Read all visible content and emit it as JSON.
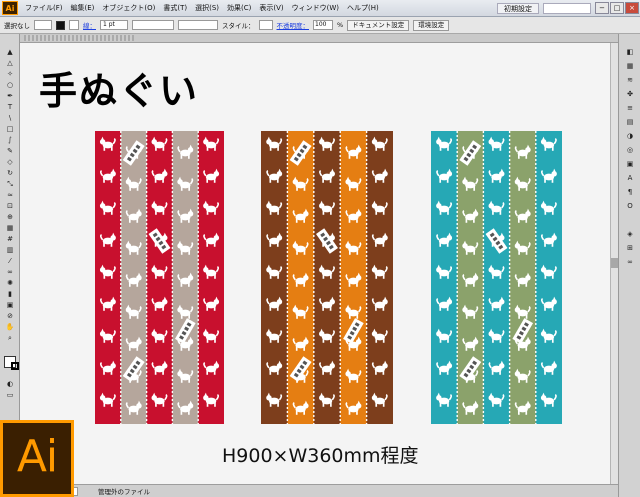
{
  "menubar": {
    "logo": "Ai",
    "items": [
      "ファイル(F)",
      "編集(E)",
      "オブジェクト(O)",
      "書式(T)",
      "選択(S)",
      "効果(C)",
      "表示(V)",
      "ウィンドウ(W)",
      "ヘルプ(H)"
    ],
    "workspace": "初期設定",
    "window_buttons": [
      "−",
      "□",
      "×"
    ]
  },
  "controlbar": {
    "selection": "選択なし",
    "stroke_label": "線：",
    "stroke_width": "1 pt",
    "style_label": "スタイル：",
    "opacity_label": "不透明度：",
    "opacity_value": "100",
    "opacity_unit": "%",
    "doc_settings": "ドキュメント設定",
    "prefs": "環境設定"
  },
  "canvas": {
    "title": "手ぬぐい",
    "caption": "H900×W360mm程度"
  },
  "towels": [
    {
      "name": "red",
      "colors": [
        "#c8102e",
        "#b5a69c"
      ]
    },
    {
      "name": "brown",
      "colors": [
        "#7d3e1c",
        "#e57e12"
      ]
    },
    {
      "name": "teal",
      "colors": [
        "#26a8b5",
        "#8ba26b"
      ]
    }
  ],
  "statusbar": {
    "status": "管理外のファイル"
  },
  "big_logo": "Ai"
}
